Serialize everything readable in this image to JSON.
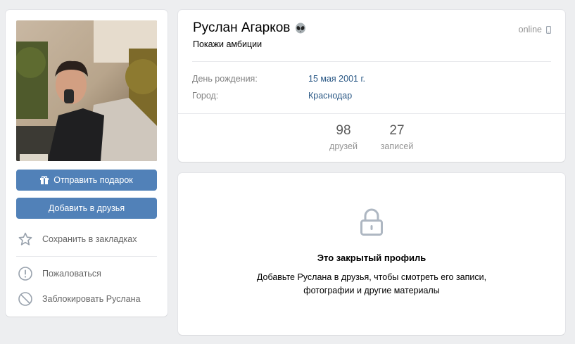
{
  "profile": {
    "name": "Руслан Агарков",
    "status": "Покажи амбиции",
    "online": "online",
    "birthday_label": "День рождения:",
    "birthday_value": "15 мая 2001 г.",
    "city_label": "Город:",
    "city_value": "Краснодар"
  },
  "counters": {
    "friends_count": "98",
    "friends_label": "друзей",
    "posts_count": "27",
    "posts_label": "записей"
  },
  "actions": {
    "send_gift": "Отправить подарок",
    "add_friend": "Добавить в друзья",
    "bookmark": "Сохранить в закладках",
    "report": "Пожаловаться",
    "block": "Заблокировать Руслана"
  },
  "closed": {
    "title": "Это закрытый профиль",
    "line1": "Добавьте Руслана в друзья, чтобы смотреть его записи,",
    "line2": "фотографии и другие материалы"
  },
  "colors": {
    "accent": "#5181b8",
    "link": "#2a5885",
    "background": "#edeef0"
  },
  "icons": [
    "gift-icon",
    "alien-emoji-icon",
    "phone-icon",
    "star-icon",
    "exclamation-icon",
    "block-icon",
    "lock-icon"
  ]
}
